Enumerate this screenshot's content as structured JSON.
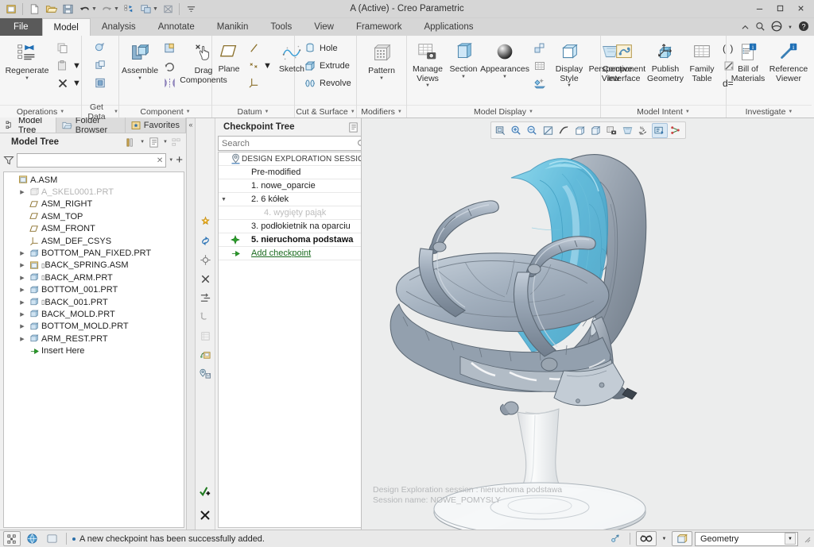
{
  "window": {
    "title": "A (Active) - Creo Parametric",
    "minimize": "—",
    "maximize": "☐",
    "close": "✕"
  },
  "quick_access": {
    "items": [
      {
        "name": "new-window-icon",
        "tip": "New Window"
      },
      {
        "name": "new-file-icon",
        "tip": "New"
      },
      {
        "name": "open-file-icon",
        "tip": "Open"
      },
      {
        "name": "save-icon",
        "tip": "Save"
      },
      {
        "name": "undo-icon",
        "tip": "Undo"
      },
      {
        "name": "redo-icon",
        "tip": "Redo"
      },
      {
        "name": "regenerate-icon",
        "tip": "Regenerate"
      },
      {
        "name": "window-switch-icon",
        "tip": "Switch Window"
      },
      {
        "name": "close-window-icon",
        "tip": "Close"
      },
      {
        "name": "customize-qat-icon",
        "tip": "Customize Quick Access Toolbar"
      }
    ]
  },
  "tabs": [
    {
      "label": "File",
      "kind": "file"
    },
    {
      "label": "Model",
      "active": true
    },
    {
      "label": "Analysis"
    },
    {
      "label": "Annotate"
    },
    {
      "label": "Manikin"
    },
    {
      "label": "Tools"
    },
    {
      "label": "View"
    },
    {
      "label": "Framework"
    },
    {
      "label": "Applications"
    }
  ],
  "titlebar_right_icons": [
    "chevron-up-icon",
    "search-icon",
    "account-icon",
    "help-icon"
  ],
  "ribbon": {
    "groups": [
      {
        "label": "Operations",
        "big": [
          {
            "label": "Regenerate",
            "icon": "regenerate-icon",
            "dropdown": true
          }
        ],
        "small": [
          {
            "label": "",
            "icon": "copy-icon"
          },
          {
            "label": "",
            "icon": "paste-icon",
            "dropdown": true
          },
          {
            "label": "",
            "icon": "delete-icon",
            "dropdown": true
          }
        ]
      },
      {
        "label": "Get Data",
        "small": [
          {
            "label": "",
            "icon": "import-icon"
          },
          {
            "label": "",
            "icon": "merge-icon"
          },
          {
            "label": "",
            "icon": "shrinkwrap-icon"
          }
        ]
      },
      {
        "label": "Component",
        "big": [
          {
            "label": "Assemble",
            "icon": "assemble-icon",
            "dropdown": true
          },
          {
            "label": "Drag\nComponents",
            "icon": "drag-components-icon"
          }
        ],
        "small": [
          {
            "label": "",
            "icon": "create-component-icon"
          },
          {
            "label": "",
            "icon": "repeat-icon"
          },
          {
            "label": "",
            "icon": "mirror-component-icon"
          }
        ]
      },
      {
        "label": "Datum",
        "big": [
          {
            "label": "Plane",
            "icon": "datum-plane-icon"
          },
          {
            "label": "Sketch",
            "icon": "sketch-icon"
          }
        ],
        "small": [
          {
            "label": "",
            "icon": "datum-axis-icon"
          },
          {
            "label": "",
            "icon": "datum-point-icon",
            "dropdown": true
          },
          {
            "label": "",
            "icon": "datum-csys-icon"
          }
        ]
      },
      {
        "label": "Cut & Surface",
        "small": [
          {
            "label": "Hole",
            "icon": "hole-icon"
          },
          {
            "label": "Extrude",
            "icon": "extrude-icon"
          },
          {
            "label": "Revolve",
            "icon": "revolve-icon"
          }
        ]
      },
      {
        "label": "Modifiers",
        "big": [
          {
            "label": "Pattern",
            "icon": "pattern-icon",
            "dropdown": true
          }
        ]
      },
      {
        "label": "Model Display",
        "big": [
          {
            "label": "Manage\nViews",
            "icon": "manage-views-icon",
            "dropdown": true
          },
          {
            "label": "Section",
            "icon": "section-icon",
            "dropdown": true
          },
          {
            "label": "Appearances",
            "icon": "appearances-icon",
            "dropdown": true
          },
          {
            "label": "Display\nStyle",
            "icon": "display-style-icon",
            "dropdown": true
          },
          {
            "label": "Perspective\nView",
            "icon": "perspective-view-icon"
          }
        ],
        "small": [
          {
            "label": "",
            "icon": "explode-view-icon"
          },
          {
            "label": "",
            "icon": "layers-icon"
          },
          {
            "label": "",
            "icon": "color-effects-icon"
          }
        ]
      },
      {
        "label": "Model Intent",
        "big": [
          {
            "label": "Component\nInterface",
            "icon": "component-interface-icon"
          },
          {
            "label": "Publish\nGeometry",
            "icon": "publish-geometry-icon"
          },
          {
            "label": "Family\nTable",
            "icon": "family-table-icon"
          }
        ],
        "small": [
          {
            "label": "( )",
            "icon": "parameters-icon"
          },
          {
            "label": "",
            "icon": "relations-icon"
          },
          {
            "label": "d=",
            "icon": "switch-dimensions-icon"
          }
        ]
      },
      {
        "label": "Investigate",
        "big": [
          {
            "label": "Bill of\nMaterials",
            "icon": "bill-of-materials-icon"
          },
          {
            "label": "Reference\nViewer",
            "icon": "reference-viewer-icon"
          }
        ]
      }
    ]
  },
  "navigator": {
    "tabs": [
      {
        "label": "Model Tree",
        "icon": "model-tree-icon",
        "active": true
      },
      {
        "label": "Folder Browser",
        "icon": "folder-browser-icon"
      },
      {
        "label": "Favorites",
        "icon": "favorites-icon"
      }
    ],
    "header": "Model Tree",
    "header_icons": [
      "settings-tools-icon",
      "display-options-icon",
      "tree-columns-icon"
    ],
    "filter": {
      "value": "",
      "placeholder": ""
    },
    "filter_icons": [
      "filter-icon",
      "clear-icon",
      "filter-dropdown-icon",
      "add-icon"
    ],
    "tree": [
      {
        "label": "A.ASM",
        "icon": "assembly-icon",
        "indent": 0,
        "expand": ""
      },
      {
        "label": "A_SKEL0001.PRT",
        "icon": "skeleton-icon",
        "indent": 1,
        "expand": "▶",
        "dim": true
      },
      {
        "label": "ASM_RIGHT",
        "icon": "datum-plane-icon",
        "indent": 1,
        "expand": ""
      },
      {
        "label": "ASM_TOP",
        "icon": "datum-plane-icon",
        "indent": 1,
        "expand": ""
      },
      {
        "label": "ASM_FRONT",
        "icon": "datum-plane-icon",
        "indent": 1,
        "expand": ""
      },
      {
        "label": "ASM_DEF_CSYS",
        "icon": "datum-csys-icon",
        "indent": 1,
        "expand": ""
      },
      {
        "label": "BOTTOM_PAN_FIXED.PRT",
        "icon": "part-icon",
        "indent": 1,
        "expand": "▶"
      },
      {
        "label": "BACK_SPRING.ASM",
        "icon": "assembly-icon",
        "indent": 1,
        "expand": "▶",
        "badge": "⬚"
      },
      {
        "label": "BACK_ARM.PRT",
        "icon": "part-icon",
        "indent": 1,
        "expand": "▶",
        "badge": "⬚"
      },
      {
        "label": "BOTTOM_001.PRT",
        "icon": "part-icon",
        "indent": 1,
        "expand": "▶"
      },
      {
        "label": "BACK_001.PRT",
        "icon": "part-icon",
        "indent": 1,
        "expand": "▶",
        "badge": "⬚"
      },
      {
        "label": "BACK_MOLD.PRT",
        "icon": "part-icon",
        "indent": 1,
        "expand": "▶"
      },
      {
        "label": "BOTTOM_MOLD.PRT",
        "icon": "part-icon",
        "indent": 1,
        "expand": "▶"
      },
      {
        "label": "ARM_REST.PRT",
        "icon": "part-icon",
        "indent": 1,
        "expand": "▶"
      },
      {
        "label": "Insert Here",
        "icon": "insert-here-icon",
        "indent": 1,
        "expand": ""
      }
    ]
  },
  "checkpoint": {
    "header": "Checkpoint Tree",
    "header_icons": [
      "checkpoint-options-icon",
      "chevron-down-icon"
    ],
    "search": {
      "value": "",
      "placeholder": "Search"
    },
    "search_icon": "search-icon",
    "rows": [
      {
        "label": "DESIGN EXPLORATION SESSION",
        "icon": "session-marker-icon",
        "style": "session",
        "expand": ""
      },
      {
        "label": "Pre-modified",
        "icon": "",
        "style": "normal",
        "expand": "",
        "indent": 2
      },
      {
        "label": "1. nowe_oparcie",
        "icon": "",
        "style": "normal",
        "expand": "",
        "indent": 2
      },
      {
        "label": "2. 6 kółek",
        "icon": "",
        "style": "normal",
        "expand": "▼",
        "indent": 2
      },
      {
        "label": "4. wygięty pająk",
        "icon": "",
        "style": "dim",
        "expand": "",
        "indent": 3
      },
      {
        "label": "3. podłokietnik na oparciu",
        "icon": "",
        "style": "normal",
        "expand": "",
        "indent": 2
      },
      {
        "label": "5. nieruchoma podstawa",
        "icon": "checkpoint-marker-icon",
        "style": "bold",
        "expand": "",
        "indent": 2
      },
      {
        "label": "Add checkpoint",
        "icon": "add-checkpoint-icon",
        "style": "link",
        "expand": "",
        "indent": 2
      }
    ],
    "tools": [
      {
        "name": "improve-icon"
      },
      {
        "name": "regenerate-checkpoint-icon"
      },
      {
        "name": "target-icon"
      },
      {
        "name": "remove-icon"
      },
      {
        "name": "compare-icon"
      },
      {
        "name": "measure-icon"
      },
      {
        "name": "table-icon"
      },
      {
        "name": "save-session-icon"
      },
      {
        "name": "save-checkpoint-icon"
      }
    ],
    "bottom_tools": [
      {
        "name": "apply-and-exit-icon"
      },
      {
        "name": "cancel-icon"
      }
    ]
  },
  "graphics": {
    "toolbar": [
      {
        "name": "refit-icon",
        "active": false
      },
      {
        "name": "zoom-in-icon",
        "active": false
      },
      {
        "name": "zoom-out-icon",
        "active": false
      },
      {
        "name": "repaint-icon",
        "active": false
      },
      {
        "name": "show-datums-icon",
        "active": false
      },
      {
        "name": "display-style-icon",
        "active": false
      },
      {
        "name": "saved-orientations-icon",
        "active": false
      },
      {
        "name": "view-manager-icon",
        "active": false
      },
      {
        "name": "perspective-icon",
        "active": false
      },
      {
        "name": "annotation-display-icon",
        "active": false
      },
      {
        "name": "spin-center-icon",
        "active": true
      },
      {
        "name": "component-display-icon",
        "active": false
      }
    ],
    "overlay": {
      "line1": "Design Exploration session : nieruchoma podstawa",
      "line2": "Session name: NOWE_POMYSLY"
    },
    "model": {
      "name": "office-chair-assembly",
      "backrest_color": "#5dbcd8",
      "frame_color": "#97a3b2",
      "seat_color": "#a8b4c2",
      "base_color": "#f2f3f4"
    }
  },
  "statusbar": {
    "left_icons": [
      "selection-filter-icon",
      "web-tools-icon",
      "message-area-icon"
    ],
    "message": "A new checkpoint has been successfully added.",
    "right_icons": [
      "snapshot-icon",
      "search-selection-icon",
      "selection-dropdown-icon",
      "model-display-icon"
    ],
    "selection_filter": {
      "value": "Geometry",
      "arrow": "▼"
    }
  }
}
